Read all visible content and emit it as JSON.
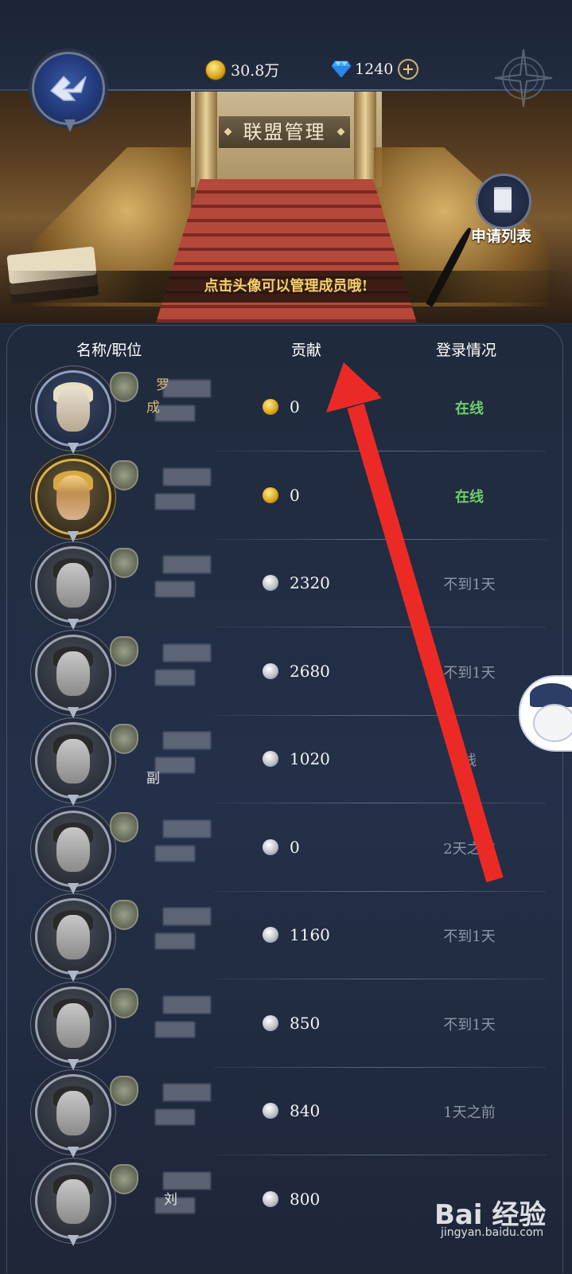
{
  "header": {
    "gold": "30.8万",
    "diamonds": "1240"
  },
  "banner": {
    "title": "联盟管理",
    "hint": "点击头像可以管理成员哦!",
    "application_list_label": "申请列表"
  },
  "table": {
    "columns": [
      "名称/职位",
      "贡献",
      "登录情况"
    ],
    "rows": [
      {
        "name_fragment": "罗",
        "role_fragment": "成",
        "contribution": "0",
        "coin": "gold",
        "status": "在线",
        "online": true,
        "frame": "blue"
      },
      {
        "name_fragment": "",
        "role_fragment": "",
        "contribution": "0",
        "coin": "gold",
        "status": "在线",
        "online": true,
        "frame": "gold"
      },
      {
        "name_fragment": "",
        "role_fragment": "",
        "contribution": "2320",
        "coin": "silver",
        "status": "不到1天",
        "online": false,
        "frame": "silver"
      },
      {
        "name_fragment": "",
        "role_fragment": "",
        "contribution": "2680",
        "coin": "silver",
        "status": "不到1天",
        "online": false,
        "frame": "silver"
      },
      {
        "name_fragment": "",
        "role_fragment": "副",
        "contribution": "1020",
        "coin": "silver",
        "status": "线",
        "online": false,
        "frame": "silver"
      },
      {
        "name_fragment": "",
        "role_fragment": "",
        "contribution": "0",
        "coin": "silver",
        "status": "2天之前",
        "online": false,
        "frame": "silver"
      },
      {
        "name_fragment": "",
        "role_fragment": "",
        "contribution": "1160",
        "coin": "silver",
        "status": "不到1天",
        "online": false,
        "frame": "silver"
      },
      {
        "name_fragment": "",
        "role_fragment": "",
        "contribution": "850",
        "coin": "silver",
        "status": "不到1天",
        "online": false,
        "frame": "silver"
      },
      {
        "name_fragment": "",
        "role_fragment": "",
        "contribution": "840",
        "coin": "silver",
        "status": "1天之前",
        "online": false,
        "frame": "silver"
      },
      {
        "name_fragment": "刘",
        "role_fragment": "",
        "contribution": "800",
        "coin": "silver",
        "status": "",
        "online": false,
        "frame": "silver"
      }
    ]
  },
  "watermark": {
    "brand": "Bai 经验",
    "url": "jingyan.baidu.com"
  },
  "colors": {
    "online": "#6fcf6a",
    "offline": "#8e97a6",
    "hint": "#f3d26a",
    "arrow": "#ec2a25"
  }
}
